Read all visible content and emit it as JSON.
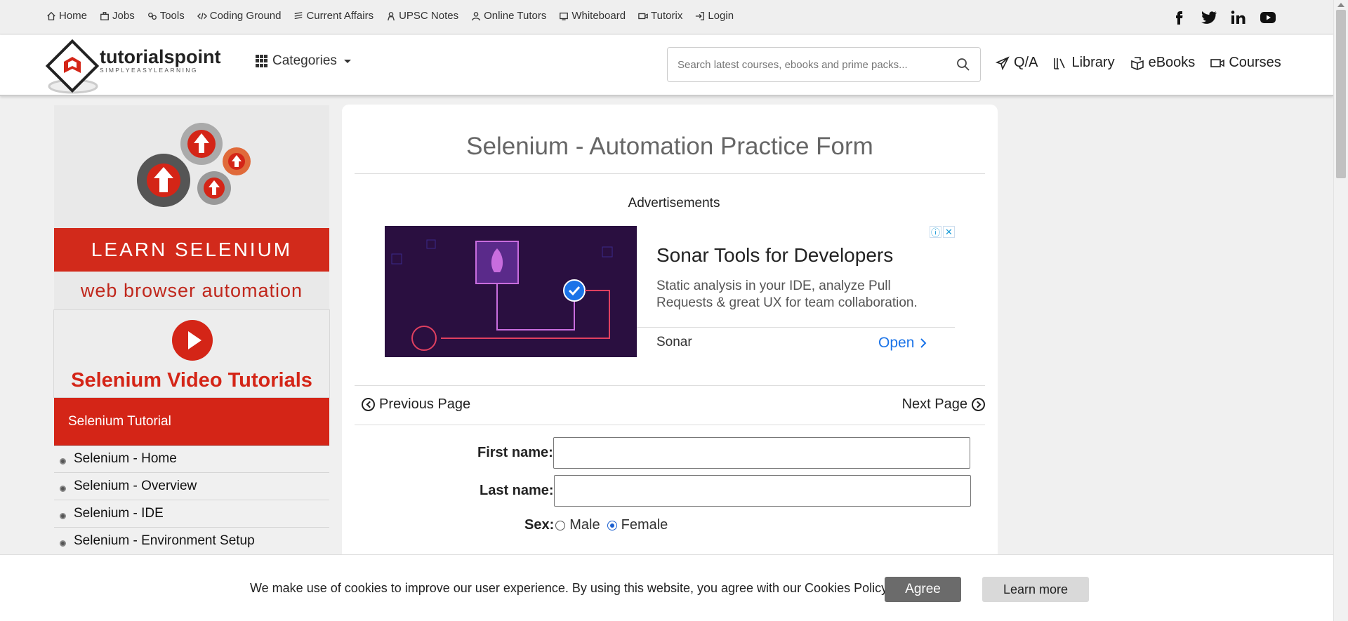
{
  "topnav": [
    {
      "label": "Home",
      "icon": "home-icon"
    },
    {
      "label": "Jobs",
      "icon": "briefcase-icon"
    },
    {
      "label": "Tools",
      "icon": "tools-icon"
    },
    {
      "label": "Coding Ground",
      "icon": "code-icon"
    },
    {
      "label": "Current Affairs",
      "icon": "news-icon"
    },
    {
      "label": "UPSC Notes",
      "icon": "notes-icon"
    },
    {
      "label": "Online Tutors",
      "icon": "user-icon"
    },
    {
      "label": "Whiteboard",
      "icon": "whiteboard-icon"
    },
    {
      "label": "Tutorix",
      "icon": "video-icon"
    },
    {
      "label": "Login",
      "icon": "login-icon"
    }
  ],
  "social": [
    "facebook-icon",
    "twitter-icon",
    "linkedin-icon",
    "youtube-icon"
  ],
  "header": {
    "logo_text": "tutorialspoint",
    "logo_tagline": "SIMPLYEASYLEARNING",
    "categories_label": "Categories",
    "search_placeholder": "Search latest courses, ebooks and prime packs...",
    "nav": [
      {
        "label": "Q/A",
        "icon": "paper-plane-icon"
      },
      {
        "label": "Library",
        "icon": "library-icon"
      },
      {
        "label": "eBooks",
        "icon": "book-icon"
      },
      {
        "label": "Courses",
        "icon": "video-camera-icon"
      }
    ]
  },
  "sidebar": {
    "banner_title": "LEARN SELENIUM",
    "banner_subtitle": "web browser automation",
    "video_label": "Selenium Video Tutorials",
    "tutorial_heading": "Selenium Tutorial",
    "items": [
      "Selenium - Home",
      "Selenium - Overview",
      "Selenium - IDE",
      "Selenium - Environment Setup"
    ]
  },
  "main": {
    "title": "Selenium - Automation Practice Form",
    "ads_label": "Advertisements",
    "ad": {
      "headline": "Sonar Tools for Developers",
      "body": "Static analysis in your IDE, analyze Pull Requests & great UX for team collaboration.",
      "brand": "Sonar",
      "cta": "Open"
    },
    "prev_label": "Previous Page",
    "next_label": "Next Page",
    "form": {
      "first_name_label": "First name:",
      "first_name_value": "",
      "last_name_label": "Last name:",
      "last_name_value": "",
      "sex_label": "Sex:",
      "sex_options": [
        "Male",
        "Female"
      ],
      "sex_selected": "Female"
    }
  },
  "cookie": {
    "message": "We make use of cookies to improve our user experience. By using this website, you agree with our Cookies Policy.",
    "agree_label": "Agree",
    "learn_label": "Learn more"
  },
  "colors": {
    "brand_red": "#d42517",
    "link_blue": "#1a73e8",
    "radio_blue": "#1a5fd0"
  }
}
